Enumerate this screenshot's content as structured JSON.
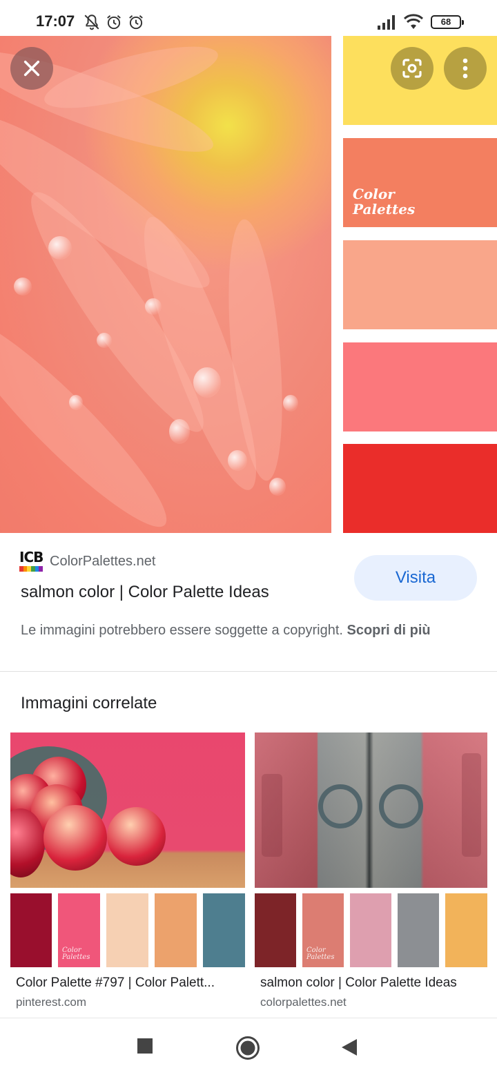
{
  "status_bar": {
    "time": "17:07",
    "battery": "68",
    "icons_left": [
      "notifications-off-icon",
      "alarm-icon",
      "alarm-icon"
    ],
    "icons_right": [
      "signal-icon",
      "wifi-icon",
      "battery-icon"
    ]
  },
  "viewer": {
    "close_icon": "close-icon",
    "lens_icon": "lens-icon",
    "more_icon": "more-vertical-icon",
    "palette_watermark": [
      "Color",
      "Palettes"
    ],
    "palette_colors": [
      "#fddf5d",
      "#f37f60",
      "#f9a68a",
      "#fb787c",
      "#ea2d2a"
    ]
  },
  "result": {
    "site_logo_text": "ICB",
    "site_name": "ColorPalettes.net",
    "title": "salmon color | Color Palette Ideas",
    "visit_label": "Visita",
    "copyright_text": "Le immagini potrebbero essere soggette a copyright.",
    "copyright_link": "Scopri di più"
  },
  "related": {
    "heading": "Immagini correlate",
    "cards": [
      {
        "title": "Color Palette #797 | Color Palett...",
        "source": "pinterest.com",
        "watermark": [
          "Color",
          "Palettes"
        ],
        "palette": [
          "#990f2d",
          "#f0567a",
          "#f6d0b3",
          "#eca26c",
          "#4e7e8f"
        ]
      },
      {
        "title": "salmon color | Color Palette Ideas",
        "source": "colorpalettes.net",
        "watermark": [
          "Color",
          "Palettes"
        ],
        "palette": [
          "#7d2428",
          "#dc7d72",
          "#de9faf",
          "#8c8f93",
          "#f2b35a"
        ]
      }
    ]
  },
  "nav_bar": {
    "recents_icon": "recents-square-icon",
    "home_icon": "home-circle-icon",
    "back_icon": "back-triangle-icon"
  }
}
